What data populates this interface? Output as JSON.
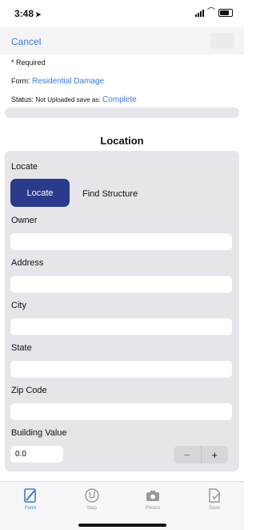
{
  "status_bar": {
    "time": "3:48",
    "location_arrow": "➤",
    "wifi_icon": "⌒"
  },
  "nav": {
    "cancel_label": "Cancel"
  },
  "meta": {
    "required_note": "* Required",
    "form_label": "Form:",
    "form_value": "Residential Damage",
    "status_label": "Status:",
    "status_value": "Not Uploaded save as:",
    "status_link": "Complete"
  },
  "section": {
    "title": "Location"
  },
  "locate": {
    "label": "Locate",
    "button_label": "Locate",
    "find_structure_label": "Find Structure"
  },
  "fields": {
    "owner_label": "Owner",
    "owner_value": "",
    "address_label": "Address",
    "address_value": "",
    "city_label": "City",
    "city_value": "",
    "state_label": "State",
    "state_value": "",
    "zip_label": "Zip Code",
    "zip_value": "",
    "building_value_label": "Building Value",
    "building_value": "0.0"
  },
  "stepper": {
    "minus": "−",
    "plus": "+"
  },
  "tabs": [
    {
      "label": "Form",
      "icon": "form-icon",
      "active": true
    },
    {
      "label": "Map",
      "icon": "globe-icon",
      "active": false
    },
    {
      "label": "Photos",
      "icon": "camera-icon",
      "active": false
    },
    {
      "label": "Save",
      "icon": "save-document-icon",
      "active": false
    }
  ],
  "colors": {
    "accent": "#3a7bd5",
    "button": "#2c3a8c",
    "panel": "#e5e5ea"
  }
}
